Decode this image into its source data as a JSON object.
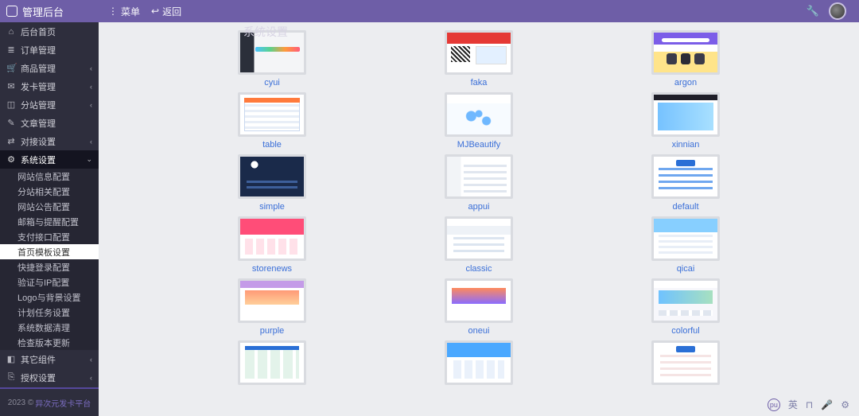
{
  "brand": "管理后台",
  "top": {
    "menu": "菜单",
    "back": "返回"
  },
  "watermark": "系统设置",
  "sidebar": {
    "items": [
      {
        "icon": "⌂",
        "label": "后台首页",
        "chev": false
      },
      {
        "icon": "≣",
        "label": "订单管理",
        "chev": false
      },
      {
        "icon": "🛒",
        "label": "商品管理",
        "chev": true
      },
      {
        "icon": "✉",
        "label": "发卡管理",
        "chev": true
      },
      {
        "icon": "◫",
        "label": "分站管理",
        "chev": true
      },
      {
        "icon": "✎",
        "label": "文章管理",
        "chev": false
      },
      {
        "icon": "⇄",
        "label": "对接设置",
        "chev": true
      },
      {
        "icon": "⚙",
        "label": "系统设置",
        "chev": true,
        "active": true
      },
      {
        "icon": "◧",
        "label": "其它组件",
        "chev": true
      },
      {
        "icon": "⎘",
        "label": "授权设置",
        "chev": true
      }
    ],
    "sub": [
      "网站信息配置",
      "分站相关配置",
      "网站公告配置",
      "邮箱与提醒配置",
      "支付接口配置",
      "首页模板设置",
      "快捷登录配置",
      "验证与IP配置",
      "Logo与背景设置",
      "计划任务设置",
      "系统数据清理",
      "检查版本更新"
    ],
    "sub_selected_index": 5,
    "footer": {
      "year": "2023 ©",
      "link": "异次元发卡平台"
    }
  },
  "templates": [
    {
      "name": "cyui",
      "cls": "th-cyui"
    },
    {
      "name": "faka",
      "cls": "th-faka"
    },
    {
      "name": "argon",
      "cls": "th-argon"
    },
    {
      "name": "table",
      "cls": "th-table"
    },
    {
      "name": "MJBeautify",
      "cls": "th-mjb"
    },
    {
      "name": "xinnian",
      "cls": "th-xin"
    },
    {
      "name": "simple",
      "cls": "th-simple"
    },
    {
      "name": "appui",
      "cls": "th-appui"
    },
    {
      "name": "default",
      "cls": "th-default"
    },
    {
      "name": "storenews",
      "cls": "th-store"
    },
    {
      "name": "classic",
      "cls": "th-classic"
    },
    {
      "name": "qicai",
      "cls": "th-qicai"
    },
    {
      "name": "purple",
      "cls": "th-purple"
    },
    {
      "name": "oneui",
      "cls": "th-oneui"
    },
    {
      "name": "colorful",
      "cls": "th-colorful"
    },
    {
      "name": "",
      "cls": "th-a"
    },
    {
      "name": "",
      "cls": "th-b"
    },
    {
      "name": "",
      "cls": "th-c"
    }
  ],
  "ime": {
    "pu": "pu",
    "lang": "英",
    "half": "⊓",
    "mic": "🎤",
    "gear": "⚙"
  }
}
